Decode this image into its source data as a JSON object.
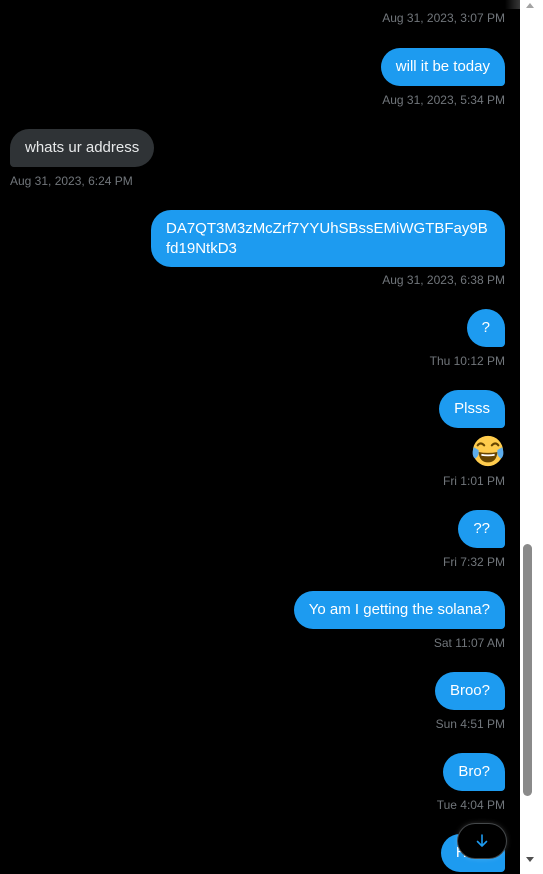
{
  "messages": [
    {
      "id": "m0",
      "direction": "out",
      "text": "",
      "time": "Aug 31, 2023, 3:07 PM"
    },
    {
      "id": "m1",
      "direction": "out",
      "text": "will it be today",
      "time": "Aug 31, 2023, 5:34 PM"
    },
    {
      "id": "m2",
      "direction": "in",
      "text": "whats ur address",
      "time": "Aug 31, 2023, 6:24 PM"
    },
    {
      "id": "m3",
      "direction": "out",
      "text": "DA7QT3M3zMcZrf7YYUhSBssEMiWGTBFay9Bfd19NtkD3",
      "time": "Aug 31, 2023, 6:38 PM"
    },
    {
      "id": "m4",
      "direction": "out",
      "text": "?",
      "time": "Thu 10:12 PM"
    },
    {
      "id": "m5",
      "direction": "out",
      "text": "Plsss",
      "emoji": "face-with-tears-of-joy",
      "time": "Fri 1:01 PM"
    },
    {
      "id": "m6",
      "direction": "out",
      "text": "??",
      "time": "Fri 7:32 PM"
    },
    {
      "id": "m7",
      "direction": "out",
      "text": "Yo am I getting the solana?",
      "time": "Sat 11:07 AM"
    },
    {
      "id": "m8",
      "direction": "out",
      "text": "Broo?",
      "time": "Sun 4:51 PM"
    },
    {
      "id": "m9",
      "direction": "out",
      "text": "Bro?",
      "time": "Tue 4:04 PM"
    },
    {
      "id": "m10",
      "direction": "out",
      "text": "Hello",
      "time": ""
    }
  ],
  "colors": {
    "background": "#000000",
    "outgoing_bubble": "#1d9bf0",
    "incoming_bubble": "#2f3336",
    "timestamp": "#71767b",
    "accent": "#1d9bf0"
  },
  "scroll_to_bottom": {
    "icon": "arrow-down-icon"
  },
  "scrollbar": {
    "position_fraction": 0.62
  }
}
